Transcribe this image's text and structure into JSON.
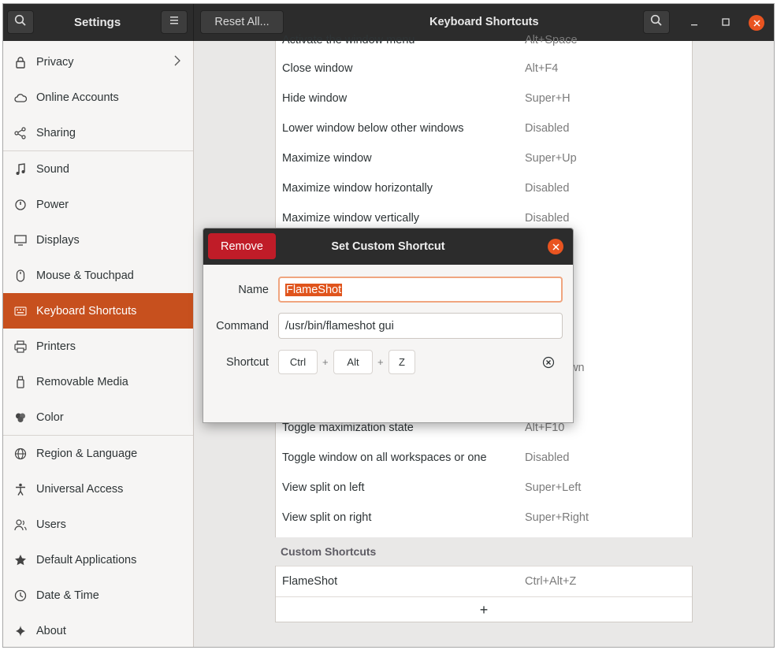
{
  "headerbar": {
    "app_title": "Settings",
    "reset_label": "Reset All...",
    "panel_title": "Keyboard Shortcuts"
  },
  "sidebar": {
    "items": [
      {
        "label": "Privacy",
        "icon": "lock-icon"
      },
      {
        "label": "Online Accounts",
        "icon": "cloud-icon"
      },
      {
        "label": "Sharing",
        "icon": "share-icon"
      },
      {
        "label": "Sound",
        "icon": "music-note-icon"
      },
      {
        "label": "Power",
        "icon": "power-icon"
      },
      {
        "label": "Displays",
        "icon": "display-icon"
      },
      {
        "label": "Mouse & Touchpad",
        "icon": "mouse-icon"
      },
      {
        "label": "Keyboard Shortcuts",
        "icon": "keyboard-icon"
      },
      {
        "label": "Printers",
        "icon": "printer-icon"
      },
      {
        "label": "Removable Media",
        "icon": "usb-drive-icon"
      },
      {
        "label": "Color",
        "icon": "color-icon"
      },
      {
        "label": "Region & Language",
        "icon": "globe-icon"
      },
      {
        "label": "Universal Access",
        "icon": "accessibility-icon"
      },
      {
        "label": "Users",
        "icon": "users-icon"
      },
      {
        "label": "Default Applications",
        "icon": "star-icon"
      },
      {
        "label": "Date & Time",
        "icon": "clock-icon"
      },
      {
        "label": "About",
        "icon": "sparkle-icon"
      }
    ],
    "active": "Keyboard Shortcuts"
  },
  "shortcuts": {
    "partial_top": {
      "name": "Activate the window menu",
      "accel": "Alt+Space"
    },
    "rows_above": [
      {
        "name": "Close window",
        "accel": "Alt+F4"
      },
      {
        "name": "Hide window",
        "accel": "Super+H"
      },
      {
        "name": "Lower window below other windows",
        "accel": "Disabled"
      },
      {
        "name": "Maximize window",
        "accel": "Super+Up"
      },
      {
        "name": "Maximize window horizontally",
        "accel": "Disabled"
      },
      {
        "name": "Maximize window vertically",
        "accel": "Disabled"
      }
    ],
    "partial_hidden": {
      "accel": "own"
    },
    "rows_below": [
      {
        "name": "Toggle maximization state",
        "accel": "Alt+F10"
      },
      {
        "name": "Toggle window on all workspaces or one",
        "accel": "Disabled"
      },
      {
        "name": "View split on left",
        "accel": "Super+Left"
      },
      {
        "name": "View split on right",
        "accel": "Super+Right"
      }
    ],
    "custom_header": "Custom Shortcuts",
    "custom_rows": [
      {
        "name": "FlameShot",
        "accel": "Ctrl+Alt+Z"
      }
    ],
    "add_label": "+"
  },
  "dialog": {
    "title": "Set Custom Shortcut",
    "remove_label": "Remove",
    "name_label": "Name",
    "name_value": "FlameShot",
    "command_label": "Command",
    "command_value": "/usr/bin/flameshot gui",
    "shortcut_label": "Shortcut",
    "keys": [
      "Ctrl",
      "Alt",
      "Z"
    ],
    "plus_sign": "+"
  },
  "colors": {
    "accent": "#e95420",
    "sidebar_active": "#c7501e",
    "remove": "#c01c28",
    "headerbar": "#2c2c2c"
  }
}
